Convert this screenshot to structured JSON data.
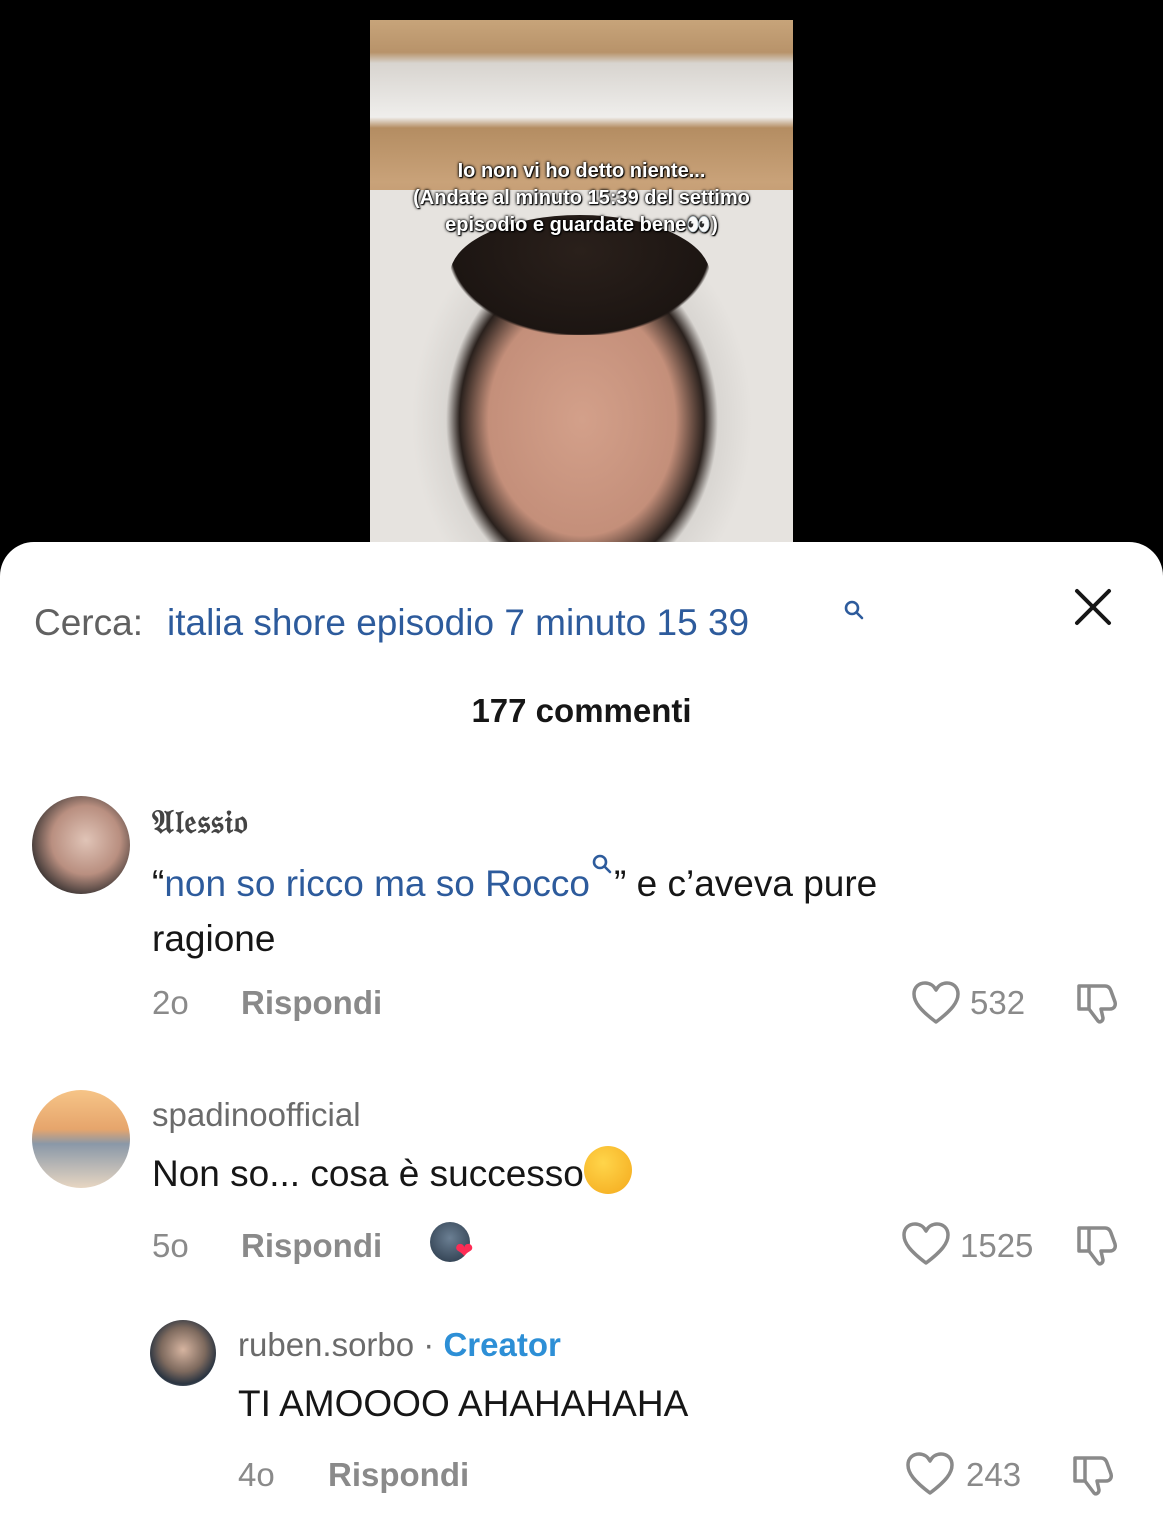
{
  "video": {
    "caption_lines": [
      "Io non vi ho detto niente...",
      "(Andate al minuto 15:39 del settimo",
      "episodio e guardate bene👀)"
    ]
  },
  "search": {
    "prefix": "Cerca:",
    "term": "italia shore episodio 7 minuto 15 39"
  },
  "comments_header": {
    "count_label": "177 commenti"
  },
  "comments": [
    {
      "username": "𝔄𝔩𝔢𝔰𝔰𝔦𝔬",
      "text_quote_open": "“",
      "text_link": "non so ricco ma so Rocco",
      "text_rest": "” e c’aveva pure",
      "text_line2": "ragione",
      "time": "2o",
      "reply_label": "Rispondi",
      "likes": "532"
    },
    {
      "username": "spadinoofficial",
      "text": "Non so... cosa è successo",
      "emoji": "thinking-face",
      "time": "5o",
      "reply_label": "Rispondi",
      "likes": "1525",
      "liked_by_creator": true
    },
    {
      "username": "ruben.sorbo",
      "separator": "·",
      "badge": "Creator",
      "text": "TI AMOOOO AHAHAHAHA",
      "time": "4o",
      "reply_label": "Rispondi",
      "likes": "243",
      "is_reply": true
    }
  ],
  "colors": {
    "link": "#2d5b9c",
    "creator": "#2d8fd6",
    "muted": "#8a8a8a",
    "heart_red": "#fe2c55"
  },
  "icons": [
    "search-icon",
    "close-icon",
    "heart-icon",
    "dislike-icon"
  ]
}
